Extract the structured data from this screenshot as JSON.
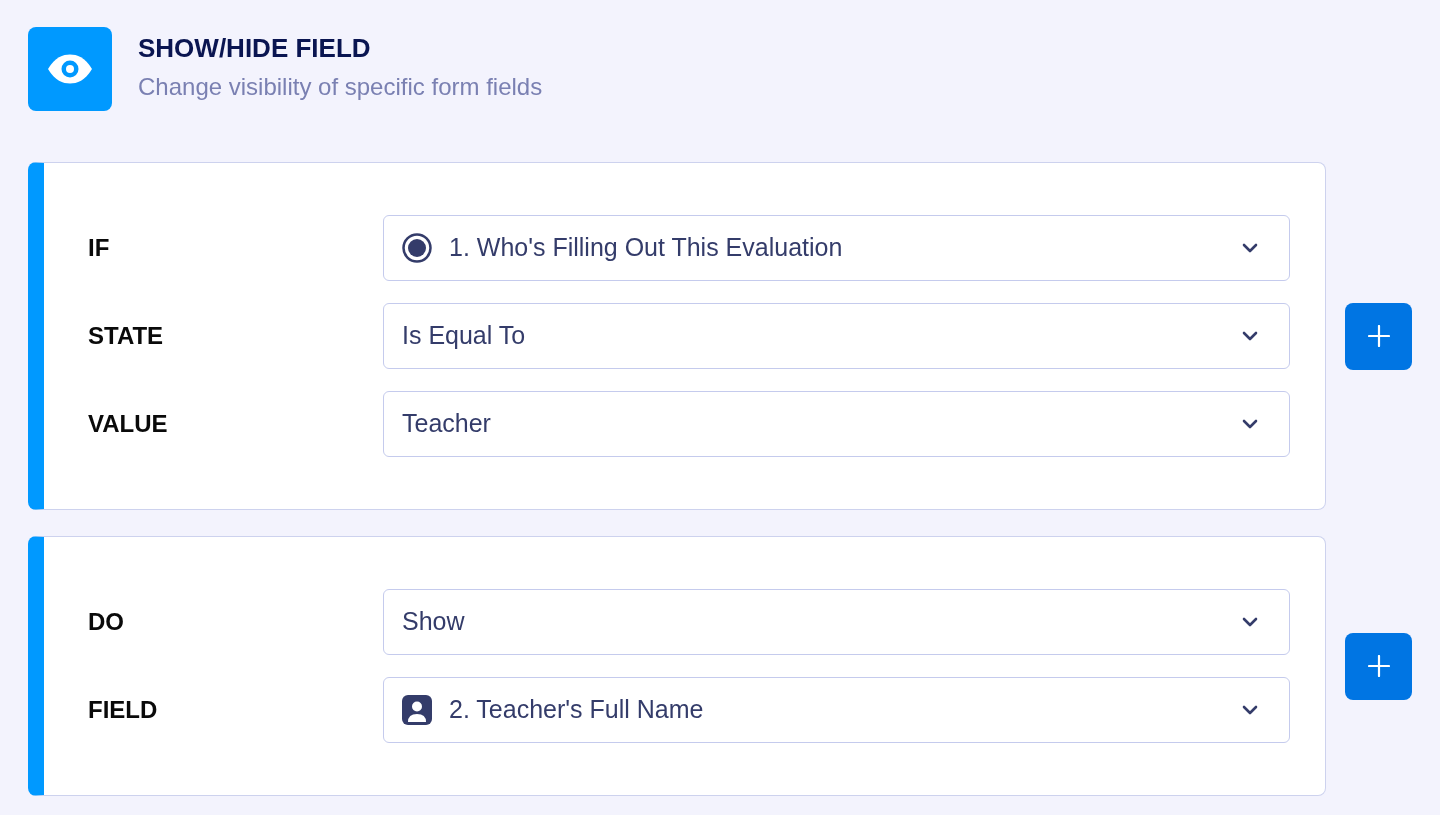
{
  "header": {
    "title": "SHOW/HIDE FIELD",
    "subtitle": "Change visibility of specific form fields"
  },
  "sections": [
    {
      "rows": [
        {
          "label": "IF",
          "kind": "radio",
          "value": "1. Who's Filling Out This Evaluation"
        },
        {
          "label": "STATE",
          "kind": "plain",
          "value": "Is Equal To"
        },
        {
          "label": "VALUE",
          "kind": "plain",
          "value": "Teacher"
        }
      ]
    },
    {
      "rows": [
        {
          "label": "DO",
          "kind": "plain",
          "value": "Show"
        },
        {
          "label": "FIELD",
          "kind": "name",
          "value": "2. Teacher's Full Name"
        }
      ]
    }
  ]
}
